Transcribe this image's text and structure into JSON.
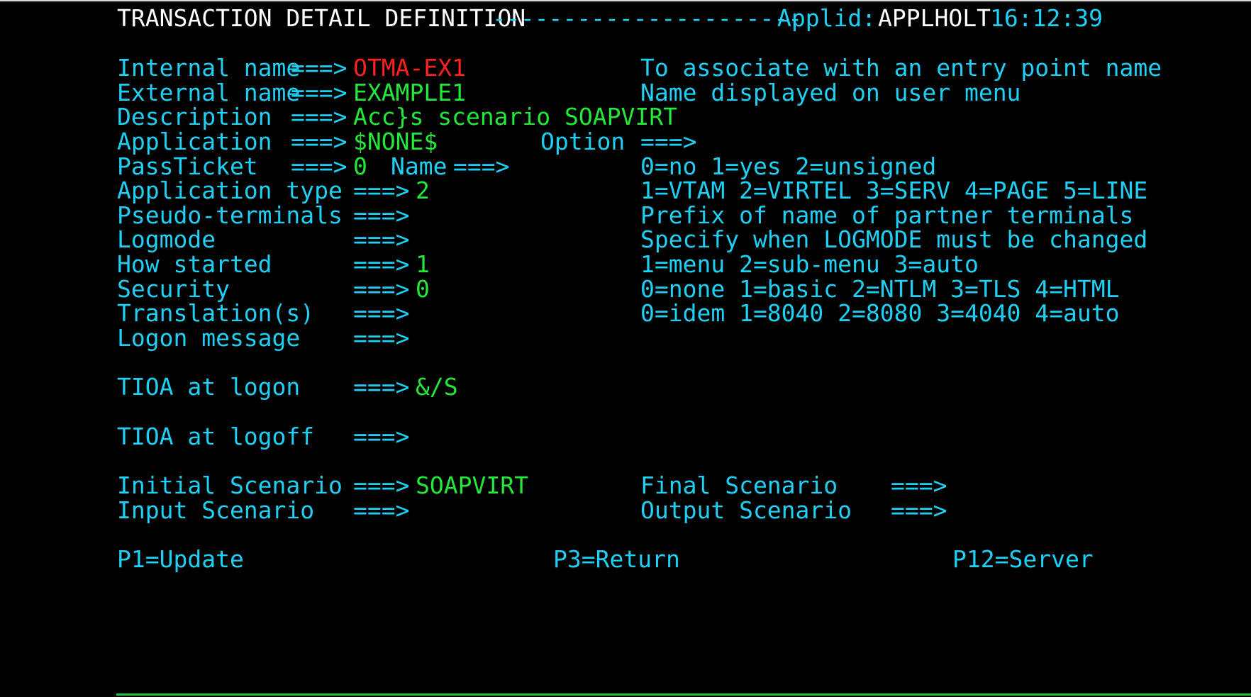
{
  "header": {
    "title": "TRANSACTION DETAIL DEFINITION",
    "dashes": "----------------------",
    "applid_label": "Applid:",
    "applid_value": "APPLHOLT",
    "time": "16:12:39"
  },
  "arrow": "===>",
  "fields": {
    "internal_name": {
      "label": "Internal name",
      "value": "OTMA-EX1",
      "hint": "To associate with an entry point name"
    },
    "external_name": {
      "label": "External name",
      "value": "EXAMPLE1",
      "hint": "Name displayed on user menu"
    },
    "description": {
      "label": "Description",
      "value": "Acc}s scenario SOAPVIRT"
    },
    "application": {
      "label": "Application",
      "value": "$NONE$",
      "option_label": "Option"
    },
    "passticket": {
      "label": "PassTicket",
      "value": "0",
      "name_label": "Name",
      "hint": "0=no 1=yes 2=unsigned"
    },
    "app_type": {
      "label": "Application type",
      "value": "2",
      "hint": "1=VTAM 2=VIRTEL 3=SERV 4=PAGE 5=LINE"
    },
    "pseudo_terminals": {
      "label": "Pseudo-terminals",
      "value": "",
      "hint": "Prefix of name of partner terminals"
    },
    "logmode": {
      "label": "Logmode",
      "value": "",
      "hint": "Specify when LOGMODE must be changed"
    },
    "how_started": {
      "label": "How started",
      "value": "1",
      "hint": "1=menu 2=sub-menu 3=auto"
    },
    "security": {
      "label": "Security",
      "value": "0",
      "hint": "0=none 1=basic 2=NTLM 3=TLS 4=HTML"
    },
    "translation": {
      "label": "Translation(s)",
      "value": "",
      "hint": "0=idem 1=8040 2=8080 3=4040 4=auto"
    },
    "logon_message": {
      "label": "Logon message",
      "value": ""
    },
    "tioa_logon": {
      "label": "TIOA at logon",
      "value": "&/S"
    },
    "tioa_logoff": {
      "label": "TIOA at logoff",
      "value": ""
    },
    "initial_scenario": {
      "label": "Initial Scenario",
      "value": "SOAPVIRT"
    },
    "final_scenario": {
      "label": "Final Scenario",
      "value": ""
    },
    "input_scenario": {
      "label": "Input Scenario",
      "value": ""
    },
    "output_scenario": {
      "label": "Output Scenario",
      "value": ""
    }
  },
  "pf_keys": {
    "p1": "P1=Update",
    "p3": "P3=Return",
    "p12": "P12=Server"
  },
  "colors": {
    "background": "#000000",
    "label": "#1fd0f5",
    "value": "#22e83a",
    "error_value": "#ff2020",
    "header_text": "#ffffff"
  }
}
